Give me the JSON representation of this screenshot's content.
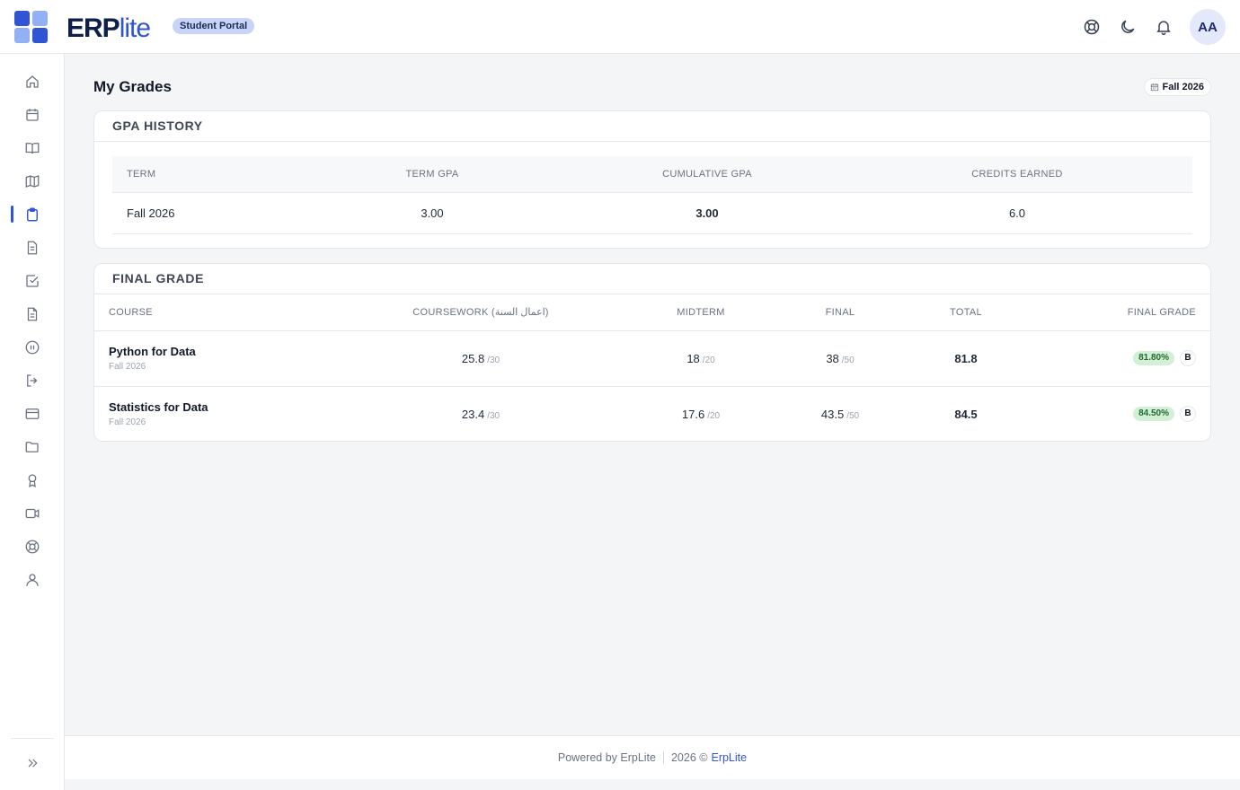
{
  "brand": {
    "erp": "ERP",
    "lite": "lite",
    "badge": "Student Portal"
  },
  "header": {
    "avatar_initials": "AA",
    "icons": [
      "help-icon",
      "moon-icon",
      "bell-icon"
    ]
  },
  "sidebar": {
    "items": [
      {
        "name": "home-icon",
        "active": false
      },
      {
        "name": "calendar-icon",
        "active": false
      },
      {
        "name": "book-icon",
        "active": false
      },
      {
        "name": "map-icon",
        "active": false
      },
      {
        "name": "clipboard-icon",
        "active": true
      },
      {
        "name": "document-icon",
        "active": false
      },
      {
        "name": "checkbox-icon",
        "active": false
      },
      {
        "name": "file-text-icon",
        "active": false
      },
      {
        "name": "pause-circle-icon",
        "active": false
      },
      {
        "name": "logout-icon",
        "active": false
      },
      {
        "name": "credit-card-icon",
        "active": false
      },
      {
        "name": "folder-icon",
        "active": false
      },
      {
        "name": "award-icon",
        "active": false
      },
      {
        "name": "video-icon",
        "active": false
      },
      {
        "name": "lifebuoy-icon",
        "active": false
      },
      {
        "name": "user-icon",
        "active": false
      }
    ],
    "expand_icon": "double-chevron-right-icon"
  },
  "page": {
    "title": "My Grades",
    "term_chip": "Fall 2026"
  },
  "gpa_history": {
    "title": "GPA HISTORY",
    "columns": [
      "TERM",
      "TERM GPA",
      "CUMULATIVE GPA",
      "CREDITS EARNED"
    ],
    "rows": [
      {
        "term": "Fall 2026",
        "term_gpa": "3.00",
        "cumulative_gpa": "3.00",
        "credits": "6.0"
      }
    ]
  },
  "final_grade": {
    "title": "FINAL GRADE",
    "columns": [
      "COURSE",
      "COURSEWORK (اعمال السنة)",
      "MIDTERM",
      "FINAL",
      "TOTAL",
      "FINAL GRADE"
    ],
    "rows": [
      {
        "course": "Python for Data",
        "term": "Fall 2026",
        "coursework": "25.8",
        "coursework_max": "/30",
        "midterm": "18",
        "midterm_max": "/20",
        "final": "38",
        "final_max": "/50",
        "total": "81.8",
        "percent": "81.80%",
        "letter": "B"
      },
      {
        "course": "Statistics for Data",
        "term": "Fall 2026",
        "coursework": "23.4",
        "coursework_max": "/30",
        "midterm": "17.6",
        "midterm_max": "/20",
        "final": "43.5",
        "final_max": "/50",
        "total": "84.5",
        "percent": "84.50%",
        "letter": "B"
      }
    ]
  },
  "footer": {
    "powered": "Powered by ErpLite",
    "copyright": "2026 ©",
    "link": "ErpLite"
  },
  "colors": {
    "accent": "#2f55d4",
    "brand_dark": "#0f1f4b",
    "grade_badge_bg": "#d3f0d6",
    "grade_badge_text": "#1f6b2e"
  }
}
